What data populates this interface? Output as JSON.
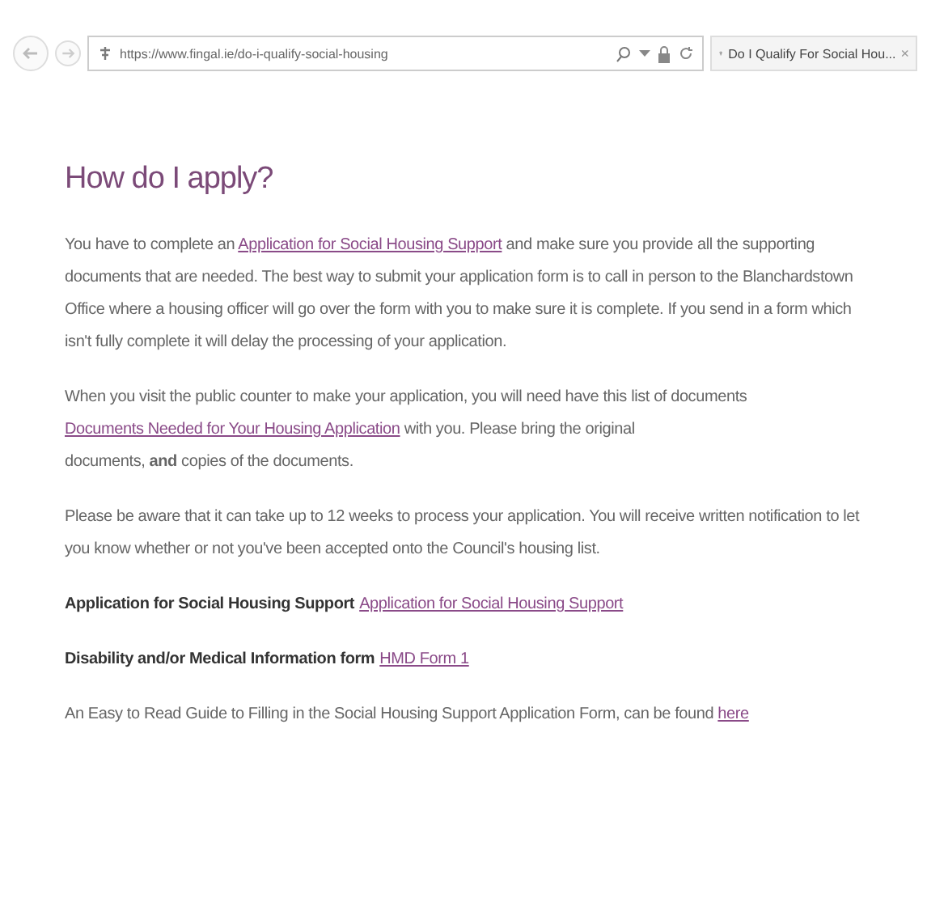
{
  "browser": {
    "url": "https://www.fingal.ie/do-i-qualify-social-housing",
    "tab": {
      "title": "Do I Qualify For Social Hou...",
      "close": "×",
      "selected": true
    }
  },
  "page": {
    "heading": "How do I apply?",
    "paragraphs": [
      {
        "kind": "text",
        "parts": [
          {
            "kind": "text",
            "text": "You have to complete an "
          },
          {
            "kind": "link",
            "text": "Application for Social Housing Support"
          },
          {
            "kind": "text",
            "text": " and make sure you provide all the supporting documents that are needed. The best way to submit your application form is to call in person to the Blanchardstown Office where a housing officer will go over the form with you to make sure it is complete. If you send in a form which isn't fully complete it will delay the processing of your application."
          }
        ]
      },
      {
        "kind": "text",
        "parts": [
          {
            "kind": "text",
            "text": "When you visit the public counter to make your application, you will need have this list of documents "
          },
          {
            "kind": "link",
            "text": "Documents Needed for Your Housing Application"
          },
          {
            "kind": "text",
            "text": " with you. Please bring the original"
          },
          {
            "kind": "break"
          },
          {
            "kind": "text",
            "text": "documents, **and** copies of the documents."
          }
        ]
      },
      {
        "kind": "text",
        "parts": [
          {
            "kind": "text",
            "text": "Please be aware that it can take up to 12 weeks to process your application. You will receive written notification to let you know whether or not you've been accepted onto the Council's housing list."
          }
        ]
      },
      {
        "kind": "text",
        "parts": [
          {
            "kind": "bold",
            "text": "Application for Social Housing Support"
          },
          {
            "kind": "link",
            "text": "Application for Social Housing Support"
          }
        ]
      },
      {
        "kind": "text",
        "parts": [
          {
            "kind": "bold",
            "text": "Disability and/or Medical Information form"
          },
          {
            "kind": "link",
            "text": "HMD Form 1"
          }
        ]
      },
      {
        "kind": "text",
        "parts": [
          {
            "kind": "text",
            "text": "An Easy to Read Guide to Filling in the Social Housing Support Application Form, can be found "
          },
          {
            "kind": "link",
            "text": "here"
          }
        ]
      }
    ]
  }
}
